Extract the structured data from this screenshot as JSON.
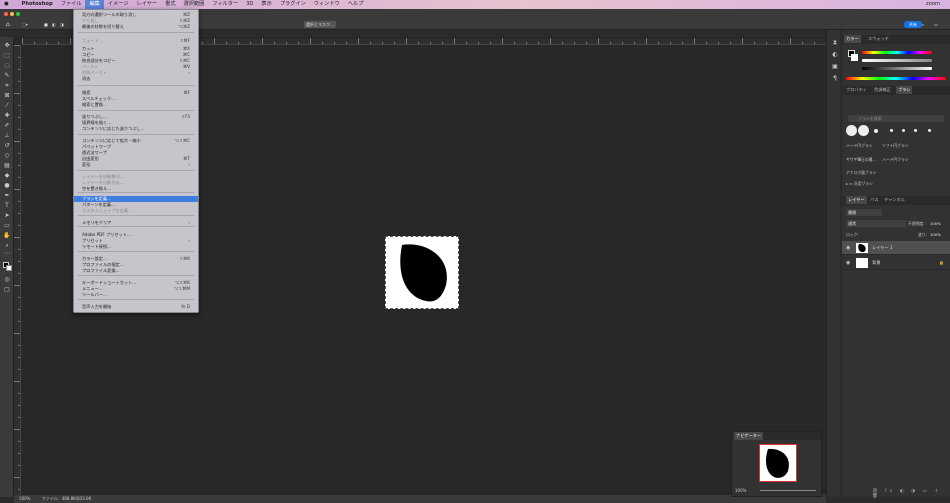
{
  "menubar": {
    "app": "Photoshop",
    "items": [
      "ファイル",
      "編集",
      "イメージ",
      "レイヤー",
      "書式",
      "選択範囲",
      "フィルター",
      "3D",
      "表示",
      "プラグイン",
      "ウィンドウ",
      "ヘルプ"
    ],
    "clock": "zoom"
  },
  "options": {
    "select_mask": "選択とマスク...",
    "share": "共有"
  },
  "edit_menu": {
    "items": [
      {
        "label": "見方向選択ツールの取り消し",
        "sc": "⌘Z",
        "state": "normal"
      },
      {
        "label": "やり直し",
        "sc": "⇧⌘Z",
        "state": "disabled"
      },
      {
        "label": "最後の状態を切り替え",
        "sc": "⌥⌘Z",
        "state": "normal"
      },
      {
        "label": "フェード...",
        "sc": "⇧⌘F",
        "state": "disabled"
      },
      {
        "label": "カット",
        "sc": "⌘X",
        "state": "normal"
      },
      {
        "label": "コピー",
        "sc": "⌘C",
        "state": "normal"
      },
      {
        "label": "結合部分をコピー",
        "sc": "⇧⌘C",
        "state": "normal"
      },
      {
        "label": "ペースト",
        "sc": "⌘V",
        "state": "disabled"
      },
      {
        "label": "特殊ペースト",
        "sc": "›",
        "state": "disabled"
      },
      {
        "label": "消去",
        "sc": "",
        "state": "normal"
      },
      {
        "label": "検索",
        "sc": "⌘F",
        "state": "normal"
      },
      {
        "label": "スペルチェック...",
        "sc": "",
        "state": "normal"
      },
      {
        "label": "検索と置換...",
        "sc": "",
        "state": "normal"
      },
      {
        "label": "塗りつぶし...",
        "sc": "⇧F5",
        "state": "normal"
      },
      {
        "label": "境界線を描く...",
        "sc": "",
        "state": "normal"
      },
      {
        "label": "コンテンツに応じた塗りつぶし...",
        "sc": "",
        "state": "normal"
      },
      {
        "label": "コンテンツに応じて拡大・縮小",
        "sc": "⌥⇧⌘C",
        "state": "normal"
      },
      {
        "label": "パペットワープ",
        "sc": "",
        "state": "normal"
      },
      {
        "label": "遠近法ワープ",
        "sc": "",
        "state": "normal"
      },
      {
        "label": "自由変形",
        "sc": "⌘T",
        "state": "normal"
      },
      {
        "label": "変形",
        "sc": "›",
        "state": "normal"
      },
      {
        "label": "レイヤーを自動整列...",
        "sc": "",
        "state": "disabled"
      },
      {
        "label": "レイヤーを自動合成...",
        "sc": "",
        "state": "disabled"
      },
      {
        "label": "空を置き換え...",
        "sc": "",
        "state": "normal"
      },
      {
        "label": "ブラシを定義...",
        "sc": "",
        "state": "highlight"
      },
      {
        "label": "パターンを定義...",
        "sc": "",
        "state": "normal"
      },
      {
        "label": "カスタムシェイプを定義...",
        "sc": "",
        "state": "disabled"
      },
      {
        "label": "メモリをクリア",
        "sc": "›",
        "state": "normal"
      },
      {
        "label": "Adobe PDF プリセット...",
        "sc": "",
        "state": "normal"
      },
      {
        "label": "プリセット",
        "sc": "›",
        "state": "normal"
      },
      {
        "label": "リモート接続...",
        "sc": "",
        "state": "normal"
      },
      {
        "label": "カラー設定...",
        "sc": "⇧⌘K",
        "state": "normal"
      },
      {
        "label": "プロファイルの指定...",
        "sc": "",
        "state": "normal"
      },
      {
        "label": "プロファイル変換...",
        "sc": "",
        "state": "normal"
      },
      {
        "label": "キーボードショートカット...",
        "sc": "⌥⇧⌘K",
        "state": "normal"
      },
      {
        "label": "メニュー...",
        "sc": "⌥⇧⌘M",
        "state": "normal"
      },
      {
        "label": "ツールバー...",
        "sc": "",
        "state": "normal"
      },
      {
        "label": "音声入力を開始",
        "sc": "fn D",
        "state": "normal"
      }
    ]
  },
  "panels": {
    "color_tabs": [
      "カラー",
      "スウォッチ"
    ],
    "props_tabs": [
      "プロパティ",
      "色調補正",
      "ブラシ"
    ],
    "brush_search": "ブラシを検索",
    "brush_names": [
      "ハード円ブラシ",
      "ソフト円ブラシ",
      "ギザギ筆圧の最...",
      "ハード円ブラシ",
      "アナログ風ブラシ"
    ],
    "brush_group": "汎用ブラシ",
    "layer_tabs": [
      "レイヤー",
      "パス",
      "チャンネル"
    ],
    "kind": "種類",
    "blend": "通常",
    "opacity_label": "不透明度：",
    "opacity": "100%",
    "lock_label": "ロック：",
    "fill_label": "塗り：",
    "fill": "100%",
    "layers": [
      "レイヤー 1",
      "背景"
    ]
  },
  "navigator": {
    "title": "ナビゲーター",
    "zoom": "100%"
  },
  "status": {
    "zoom": "100%",
    "file": "ファイル：468.8K/833.0K"
  }
}
